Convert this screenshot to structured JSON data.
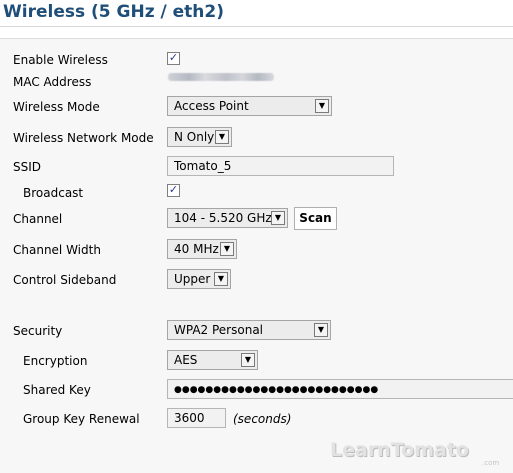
{
  "page": {
    "title": "Wireless (5 GHz / eth2)"
  },
  "fields": {
    "enable_wireless": {
      "label": "Enable Wireless",
      "checked": true
    },
    "mac_address": {
      "label": "MAC Address"
    },
    "wireless_mode": {
      "label": "Wireless Mode",
      "value": "Access Point"
    },
    "network_mode": {
      "label": "Wireless Network Mode",
      "value": "N Only"
    },
    "ssid": {
      "label": "SSID",
      "value": "Tomato_5"
    },
    "broadcast": {
      "label": "Broadcast",
      "checked": true
    },
    "channel": {
      "label": "Channel",
      "value": "104 - 5.520 GHz",
      "scan_label": "Scan"
    },
    "channel_width": {
      "label": "Channel Width",
      "value": "40 MHz"
    },
    "control_sideband": {
      "label": "Control Sideband",
      "value": "Upper"
    },
    "security": {
      "label": "Security",
      "value": "WPA2 Personal"
    },
    "encryption": {
      "label": "Encryption",
      "value": "AES"
    },
    "shared_key": {
      "label": "Shared Key",
      "value": "●●●●●●●●●●●●●●●●●●●●●●●●●●"
    },
    "group_key_renewal": {
      "label": "Group Key Renewal",
      "value": "3600",
      "unit": "(seconds)"
    }
  },
  "watermark": {
    "text": "LearnTomato",
    "suffix": ".com"
  },
  "icons": {
    "checkbox": "checkmark-icon",
    "dropdown": "triangle-down-icon"
  },
  "colors": {
    "title": "#1f4e79",
    "panel_bg": "#f7f7f7",
    "checkbox_tick": "#2a3b8f"
  }
}
